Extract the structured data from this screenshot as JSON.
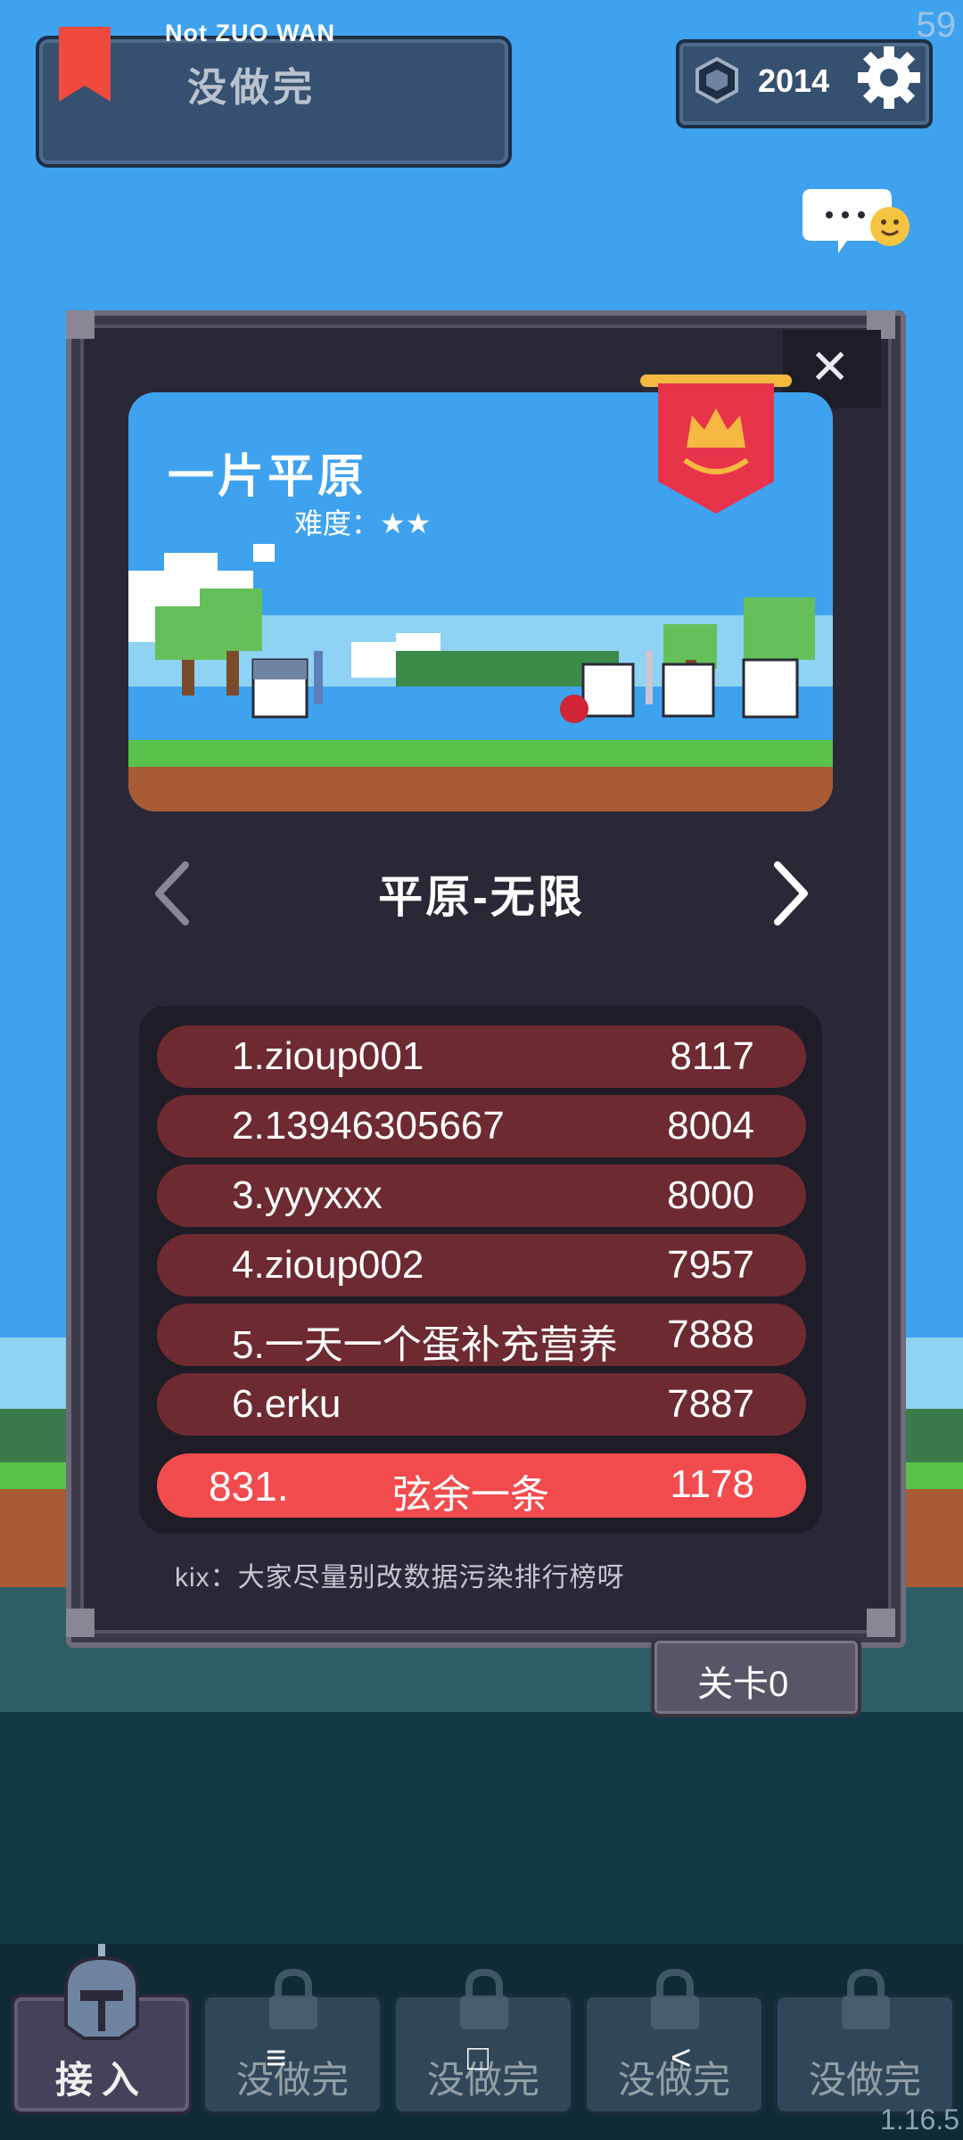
{
  "status": {
    "fps": "59",
    "version": "1.16.5"
  },
  "header": {
    "subtitle": "Not ZUO WAN",
    "title": "没做完"
  },
  "currency": {
    "value": "2014"
  },
  "icons": {
    "bookmark": "bookmark-icon",
    "gem": "gem-icon",
    "settings": "gear-icon",
    "chat": "chat-bubble-icon",
    "close": "close-icon",
    "crown": "crown-banner-icon",
    "lock": "lock-icon",
    "helmet": "helmet-icon"
  },
  "modal": {
    "close_label": "✕",
    "level_name": "一片平原",
    "difficulty_label": "难度：★★",
    "mode_title": "平原-无限",
    "leaderboard": [
      {
        "rank_name": "1.zioup001",
        "score": "8117"
      },
      {
        "rank_name": "2.13946305667",
        "score": "8004"
      },
      {
        "rank_name": "3.yyyxxx",
        "score": "8000"
      },
      {
        "rank_name": "4.zioup002",
        "score": "7957"
      },
      {
        "rank_name": "5.一天一个蛋补充营养",
        "score": "7888"
      },
      {
        "rank_name": "6.erku",
        "score": "7887"
      }
    ],
    "my_entry": {
      "rank": "831.",
      "name": "弦余一条",
      "score": "1178"
    },
    "tip": "kix：大家尽量别改数据污染排行榜呀"
  },
  "level_button": {
    "label": "关卡0"
  },
  "tabs": [
    {
      "label": "接入",
      "active": true
    },
    {
      "label": "没做完",
      "active": false
    },
    {
      "label": "没做完",
      "active": false
    },
    {
      "label": "没做完",
      "active": false
    },
    {
      "label": "没做完",
      "active": false
    }
  ],
  "system_nav": {
    "menu": "≡",
    "home": "□",
    "back": "<"
  },
  "colors": {
    "sky": "#3ea2ef",
    "panel": "#2a2836",
    "rank_row": "#6d2a30",
    "my_row": "#f24b4e",
    "banner": "#e8344a",
    "accent_gold": "#f5b942"
  }
}
